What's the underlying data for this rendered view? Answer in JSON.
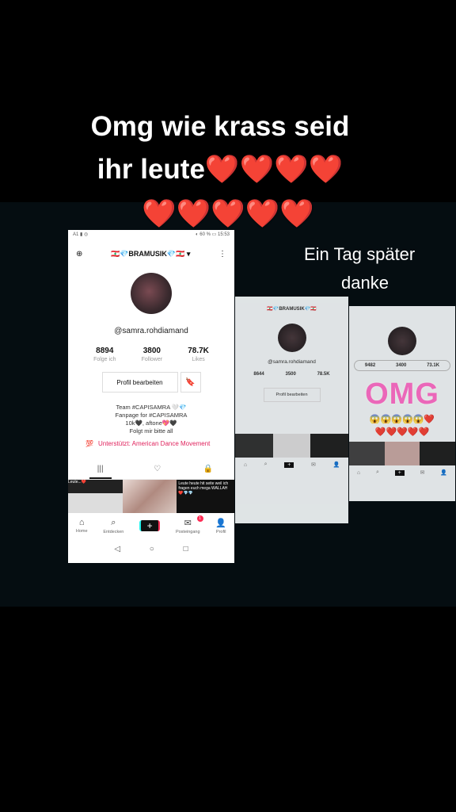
{
  "captions": {
    "line1": "Omg wie krass seid",
    "line2_text": "ihr leute",
    "line2_hearts": "❤️❤️❤️❤️",
    "line3_hearts": "❤️❤️❤️❤️❤️",
    "side1": "Ein Tag später",
    "side2": "danke"
  },
  "phone": {
    "status_left": "A1 ▮ ◎",
    "status_right": "◐ 60 % ▭ 15:53",
    "add_user_icon": "⊕",
    "account_title": "🇱🇧💎BRAMUSIK💎🇱🇧 ▾",
    "more_icon": "⋮",
    "handle": "@samra.rohdiamand",
    "stats": [
      {
        "num": "8894",
        "label": "Folge ich"
      },
      {
        "num": "3800",
        "label": "Follower"
      },
      {
        "num": "78.7K",
        "label": "Likes"
      }
    ],
    "edit_profile": "Profil bearbeiten",
    "bookmark_icon": "🔖",
    "bio": [
      "Team #CAPISAMRA 🤍💎",
      "Fanpage for #CAPISAMRA",
      "10k🖤, aftone💖🖤",
      "Folgt mir bitte all"
    ],
    "support_icon": "💯",
    "support_text": "Unterstützt: American Dance Movement",
    "tabs": [
      "|||",
      "♡",
      "🔒"
    ],
    "thumb3_text": "Leute heute hit seite weil ich fragen euch mega WALLAH ❤️💎💎",
    "thumb1_text": "Leute...❤️",
    "nav": [
      {
        "icon": "⌂",
        "label": "Home"
      },
      {
        "icon": "⌕",
        "label": "Entdecken"
      },
      {
        "icon": "+",
        "label": ""
      },
      {
        "icon": "✉",
        "label": "Posteingang",
        "badge": "1"
      },
      {
        "icon": "👤",
        "label": "Profil"
      }
    ],
    "sys_nav": [
      "◁",
      "○",
      "□"
    ]
  },
  "mini1": {
    "title": "🇱🇧💎BRAMUSIK💎🇱🇧",
    "handle": "@samra.rohdiamand",
    "stats": [
      "8644",
      "3500",
      "78.5K"
    ],
    "edit_profile": "Profil bearbeiten"
  },
  "mini2": {
    "stats": [
      "9482",
      "3400",
      "73.1K"
    ],
    "omg": "OMG",
    "emojis1": "😱😱😱😱😱❤️",
    "emojis2": "❤️❤️❤️❤️❤️"
  },
  "colors": {
    "heart": "#e0201c",
    "omg_pink": "#ff6fc8",
    "tiktok_red": "#fe2c55"
  }
}
